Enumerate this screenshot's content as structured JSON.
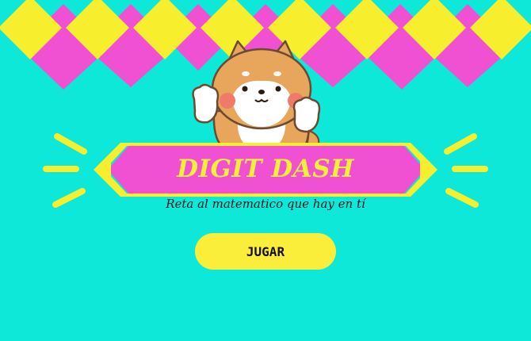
{
  "game": {
    "title": "DIGIT DASH",
    "subtitle": "Reta al matematico que hay en tí",
    "play_label": "JUGAR"
  },
  "colors": {
    "background": "#0ee8d8",
    "diamond_yellow": "#f7ee2e",
    "diamond_pink": "#f051d3",
    "banner_fill": "#f051d3",
    "banner_border": "#f7ee2e",
    "button_fill": "#fbee3a",
    "text_dark": "#1a1a1a"
  },
  "mascot": {
    "icon": "shiba-dog-mascot-icon"
  }
}
